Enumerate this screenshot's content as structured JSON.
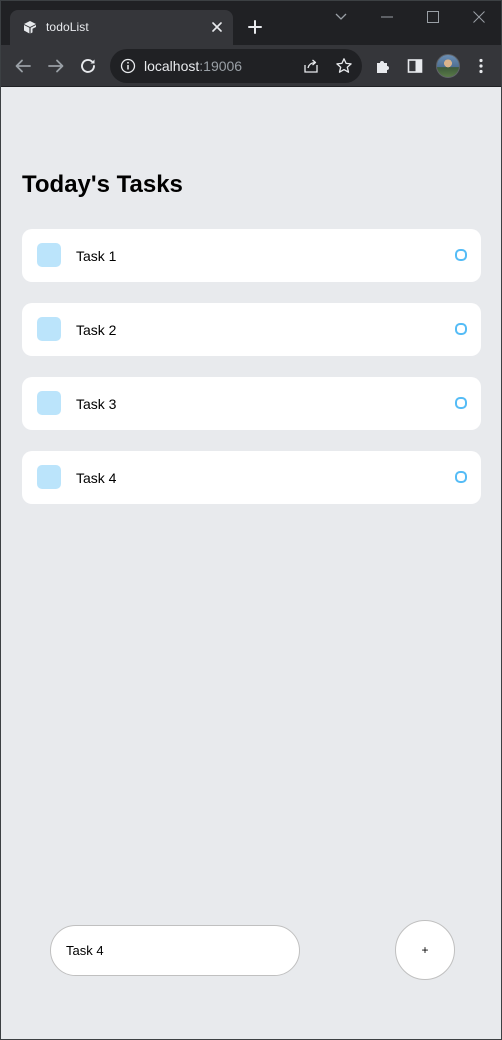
{
  "browser": {
    "tab_title": "todoList",
    "url_host": "localhost",
    "url_port": ":19006",
    "icons": {
      "favicon": "expo-logo-icon",
      "tab_close": "close-icon",
      "new_tab": "plus-icon",
      "back": "back-arrow-icon",
      "forward": "forward-arrow-icon",
      "reload": "reload-icon",
      "info": "info-icon",
      "share": "share-icon",
      "bookmark": "star-icon",
      "extensions": "puzzle-icon",
      "side_panel": "side-panel-icon",
      "menu": "kebab-menu-icon",
      "profile": "avatar"
    }
  },
  "page": {
    "title": "Today's Tasks",
    "tasks": [
      {
        "label": "Task 1"
      },
      {
        "label": "Task 2"
      },
      {
        "label": "Task 3"
      },
      {
        "label": "Task 4"
      }
    ],
    "input": {
      "value": "Task 4"
    },
    "add_button": {
      "label": "+"
    }
  },
  "colors": {
    "page_background": "#e8eaed",
    "task_background": "#ffffff",
    "accent": "#55bcf6",
    "browser_frame": "#202124",
    "browser_toolbar": "#35363a"
  }
}
